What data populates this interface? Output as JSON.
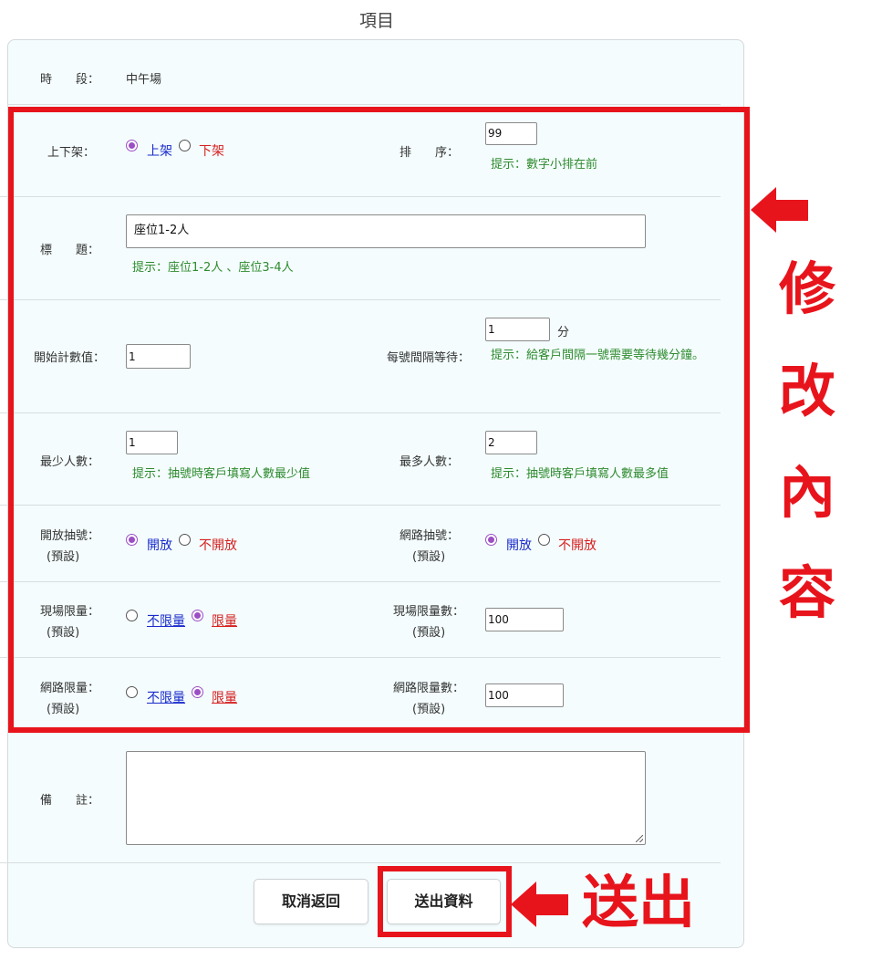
{
  "page": {
    "title": "項目"
  },
  "form": {
    "period": {
      "label": "時　　段：",
      "value": "中午場"
    },
    "status": {
      "label": "上下架：",
      "on_label": "上架",
      "off_label": "下架",
      "selected": "上架"
    },
    "sort": {
      "label": "排　　序：",
      "value": "99",
      "hint": "提示：數字小排在前"
    },
    "title_field": {
      "label": "標　　題：",
      "value": "座位1-2人",
      "hint": "提示：座位1-2人 、座位3-4人"
    },
    "start_count": {
      "label": "開始計數值：",
      "value": "1"
    },
    "interval": {
      "label": "每號間隔等待：",
      "value": "1",
      "unit": "分",
      "hint": "提示：給客戶間隔一號需要等待幾分鐘。"
    },
    "min_people": {
      "label": "最少人數：",
      "value": "1",
      "hint": "提示：抽號時客戶填寫人數最少值"
    },
    "max_people": {
      "label": "最多人數：",
      "value": "2",
      "hint": "提示：抽號時客戶填寫人數最多值"
    },
    "open_draw": {
      "label": "開放抽號：",
      "sub": "(預設)",
      "open_label": "開放",
      "closed_label": "不開放",
      "selected": "開放"
    },
    "online_draw": {
      "label": "網路抽號：",
      "sub": "(預設)",
      "open_label": "開放",
      "closed_label": "不開放",
      "selected": "開放"
    },
    "onsite_limit": {
      "label": "現場限量：",
      "sub": "(預設)",
      "unlimited_label": "不限量",
      "limited_label": "限量",
      "selected": "限量"
    },
    "onsite_limit_count": {
      "label": "現場限量數：",
      "sub": "(預設)",
      "value": "100"
    },
    "online_limit": {
      "label": "網路限量：",
      "sub": "(預設)",
      "unlimited_label": "不限量",
      "limited_label": "限量",
      "selected": "限量"
    },
    "online_limit_count": {
      "label": "網路限量數：",
      "sub": "(預設)",
      "value": "100"
    },
    "remarks": {
      "label": "備　　註：",
      "value": ""
    }
  },
  "buttons": {
    "cancel": "取消返回",
    "submit": "送出資料"
  },
  "annotations": {
    "edit_chars": [
      "修",
      "改",
      "內",
      "容"
    ],
    "submit": "送出",
    "color": "#e8141c"
  },
  "colors": {
    "hint": "#2e8b2e",
    "option_blue": "#1a2bcc",
    "option_red": "#d61f1f",
    "radio_checked": "#9c4ec4",
    "panel_bg": "#f4fcfd"
  }
}
